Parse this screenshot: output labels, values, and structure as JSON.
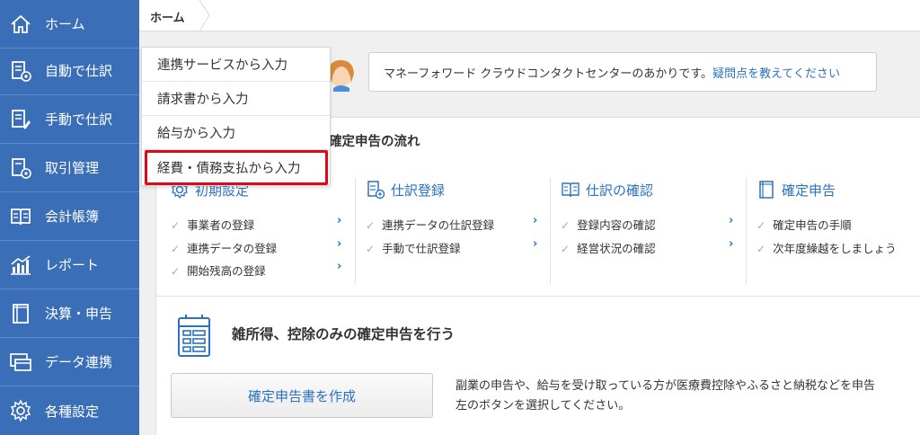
{
  "sidebar": {
    "items": [
      {
        "label": "ホーム",
        "icon": "home-icon"
      },
      {
        "label": "自動で仕訳",
        "icon": "auto-journal-icon"
      },
      {
        "label": "手動で仕訳",
        "icon": "manual-journal-icon"
      },
      {
        "label": "取引管理",
        "icon": "transaction-icon"
      },
      {
        "label": "会計帳簿",
        "icon": "ledger-icon"
      },
      {
        "label": "レポート",
        "icon": "report-icon"
      },
      {
        "label": "決算・申告",
        "icon": "settlement-icon"
      },
      {
        "label": "データ連携",
        "icon": "data-link-icon"
      },
      {
        "label": "各種設定",
        "icon": "gear-icon"
      }
    ]
  },
  "header": {
    "breadcrumb": "ホーム"
  },
  "dropdown": {
    "items": [
      "連携サービスから入力",
      "請求書から入力",
      "給与から入力",
      "経費・債務支払から入力"
    ],
    "highlighted_index": 3
  },
  "help": {
    "text": "マネーフォワード クラウドコンタクトセンターのあかりです。",
    "link": "疑問点を教えてください"
  },
  "flow": {
    "title": "確定申告の流れ",
    "steps": [
      {
        "title": "初期設定",
        "icon": "gear-icon",
        "links": [
          "事業者の登録",
          "連携データの登録",
          "開始残高の登録"
        ]
      },
      {
        "title": "仕訳登録",
        "icon": "journal-add-icon",
        "links": [
          "連携データの仕訳登録",
          "手動で仕訳登録"
        ]
      },
      {
        "title": "仕訳の確認",
        "icon": "book-icon",
        "links": [
          "登録内容の確認",
          "経営状況の確認"
        ]
      },
      {
        "title": "確定申告",
        "icon": "document-icon",
        "links": [
          "確定申告の手順",
          "次年度繰越をしましょう"
        ]
      }
    ]
  },
  "tax": {
    "title": "雑所得、控除のみの確定申告を行う",
    "button": "確定申告書を作成",
    "desc1": "副業の申告や、給与を受け取っている方が医療費控除やふるさと納税などを申告",
    "desc2": "左のボタンを選択してください。"
  },
  "colors": {
    "sidebar": "#3a6fb7",
    "accent": "#2b72c2",
    "highlight": "#e3061b"
  }
}
